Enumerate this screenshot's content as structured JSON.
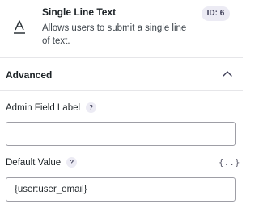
{
  "field_type": {
    "title": "Single Line Text",
    "description": "Allows users to submit a single line of text.",
    "id_badge": "ID: 6",
    "icon": "text-type-icon"
  },
  "advanced": {
    "title": "Advanced",
    "expanded": true,
    "toggle_icon": "chevron-up-icon"
  },
  "admin_field_label": {
    "label": "Admin Field Label",
    "help": "?",
    "value": ""
  },
  "default_value": {
    "label": "Default Value",
    "help": "?",
    "merge_tag_button": "{..}",
    "value": "{user:user_email}"
  },
  "colors": {
    "badge_bg": "#ecebf4",
    "border": "#9e9ea6",
    "divider": "#e6e6e9"
  }
}
